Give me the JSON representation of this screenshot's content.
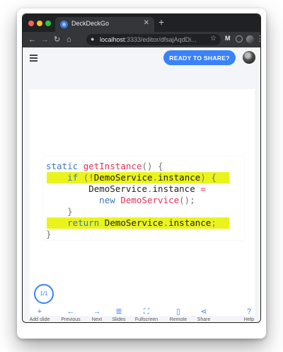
{
  "browser": {
    "tab_title": "DeckDeckGo",
    "new_tab_symbol": "+",
    "tab_close_symbol": "✕",
    "url_host": "localhost",
    "url_path": ":3333/editor/dfsajAqdDi...",
    "extension_label": "M",
    "icons": [
      "back-arrow-icon",
      "forward-arrow-icon",
      "reload-icon",
      "home-icon",
      "lock-icon",
      "star-icon",
      "menu-dots-icon"
    ]
  },
  "app": {
    "share_button": "READY TO SHARE?",
    "pager": "1/1",
    "code_lines": [
      {
        "highlight": false,
        "parts": [
          {
            "c": "kw",
            "t": "static "
          },
          {
            "c": "fn",
            "t": "getInstance"
          },
          {
            "c": "pu",
            "t": "() {"
          }
        ]
      },
      {
        "highlight": true,
        "parts": [
          {
            "c": "kw",
            "t": "    if "
          },
          {
            "c": "pu",
            "t": "("
          },
          {
            "c": "fn",
            "t": "!"
          },
          {
            "c": "pl",
            "t": "DemoService"
          },
          {
            "c": "pu",
            "t": "."
          },
          {
            "c": "pl",
            "t": "instance"
          },
          {
            "c": "pu",
            "t": ") {"
          }
        ]
      },
      {
        "highlight": false,
        "parts": [
          {
            "c": "pl",
            "t": "        DemoService"
          },
          {
            "c": "pu",
            "t": "."
          },
          {
            "c": "pl",
            "t": "instance "
          },
          {
            "c": "fn",
            "t": "="
          }
        ]
      },
      {
        "highlight": false,
        "parts": [
          {
            "c": "kw",
            "t": "          new "
          },
          {
            "c": "fn",
            "t": "DemoService"
          },
          {
            "c": "pu",
            "t": "();"
          }
        ]
      },
      {
        "highlight": false,
        "parts": [
          {
            "c": "pu",
            "t": "    }"
          }
        ]
      },
      {
        "highlight": true,
        "parts": [
          {
            "c": "kw",
            "t": "    return "
          },
          {
            "c": "pl",
            "t": "DemoService"
          },
          {
            "c": "pu",
            "t": "."
          },
          {
            "c": "pl",
            "t": "instance"
          },
          {
            "c": "pu",
            "t": ";"
          }
        ]
      },
      {
        "highlight": false,
        "parts": [
          {
            "c": "pu",
            "t": "}"
          }
        ]
      }
    ],
    "actions": [
      {
        "name": "add-slide-button",
        "icon": "+",
        "label": "Add slide"
      },
      {
        "name": "previous-button",
        "icon": "←",
        "label": "Previous"
      },
      {
        "name": "next-button",
        "icon": "→",
        "label": "Next"
      },
      {
        "name": "slides-button",
        "icon": "≣",
        "label": "Slides"
      },
      {
        "name": "fullscreen-button",
        "icon": "⛶",
        "label": "Fullscreen"
      },
      {
        "name": "remote-button",
        "icon": "▯",
        "label": "Remote"
      },
      {
        "name": "share-button",
        "icon": "⋖",
        "label": "Share"
      },
      {
        "name": "help-button",
        "icon": "?",
        "label": "Help"
      }
    ],
    "colors": {
      "accent": "#3a82f7",
      "highlight": "#eaf41c",
      "keyword": "#3d7bb8",
      "function": "#e3315a"
    }
  }
}
